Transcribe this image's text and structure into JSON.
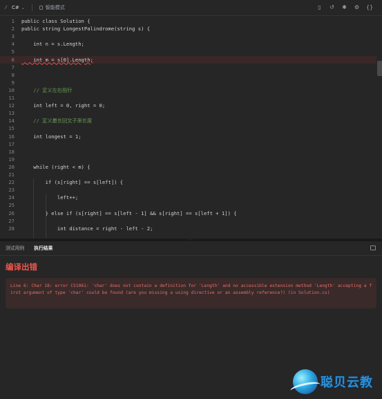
{
  "toolbar": {
    "language": "C#",
    "smart_mode": "智能模式",
    "icons": [
      "bookmark-icon",
      "reset-icon",
      "settings-tools-icon",
      "gear-icon",
      "code-brackets-icon"
    ]
  },
  "editor": {
    "lines": [
      {
        "n": "1",
        "code": "public class Solution {"
      },
      {
        "n": "2",
        "code": "public string LongestPalindrome(string s) {"
      },
      {
        "n": "3",
        "code": ""
      },
      {
        "n": "4",
        "code": "    int n = s.Length;"
      },
      {
        "n": "5",
        "code": ""
      },
      {
        "n": "6",
        "code": "    int m = s[0].Length;"
      },
      {
        "n": "7",
        "code": ""
      },
      {
        "n": "8",
        "code": ""
      },
      {
        "n": "9",
        "code": ""
      },
      {
        "n": "10",
        "code": "    // 定义左右指针"
      },
      {
        "n": "11",
        "code": ""
      },
      {
        "n": "12",
        "code": "    int left = 0, right = 0;"
      },
      {
        "n": "13",
        "code": ""
      },
      {
        "n": "14",
        "code": "    // 定义最长回文子串长度"
      },
      {
        "n": "15",
        "code": ""
      },
      {
        "n": "16",
        "code": "    int longest = 1;"
      },
      {
        "n": "17",
        "code": ""
      },
      {
        "n": "18",
        "code": ""
      },
      {
        "n": "19",
        "code": ""
      },
      {
        "n": "20",
        "code": "    while (right < m) {"
      },
      {
        "n": "21",
        "code": ""
      },
      {
        "n": "22",
        "code": "        if (s[right] == s[left]) {"
      },
      {
        "n": "23",
        "code": ""
      },
      {
        "n": "24",
        "code": "            left++;"
      },
      {
        "n": "25",
        "code": ""
      },
      {
        "n": "26",
        "code": "        } else if (s[right] == s[left - 1] && s[right] == s[left + 1]) {"
      },
      {
        "n": "27",
        "code": ""
      },
      {
        "n": "28",
        "code": "            int distance = right - left - 2;"
      }
    ]
  },
  "result": {
    "tabs": [
      "测试用例",
      "执行结果"
    ],
    "active_tab": "执行结果",
    "title": "编译出错",
    "error_message": "Line 6: Char 18: error CS1061: 'char' does not contain a definition for 'Length' and no accessible extension method 'Length' accepting a first argument of type 'char' could be found (are you missing a using directive or an assembly reference?) (in Solution.cs)"
  },
  "watermark": {
    "text": "聪贝云教"
  },
  "colors": {
    "error_red": "#f0554d",
    "error_bg": "#3a2a2a",
    "editor_bg": "#262626",
    "comment_green": "#6a9955"
  }
}
